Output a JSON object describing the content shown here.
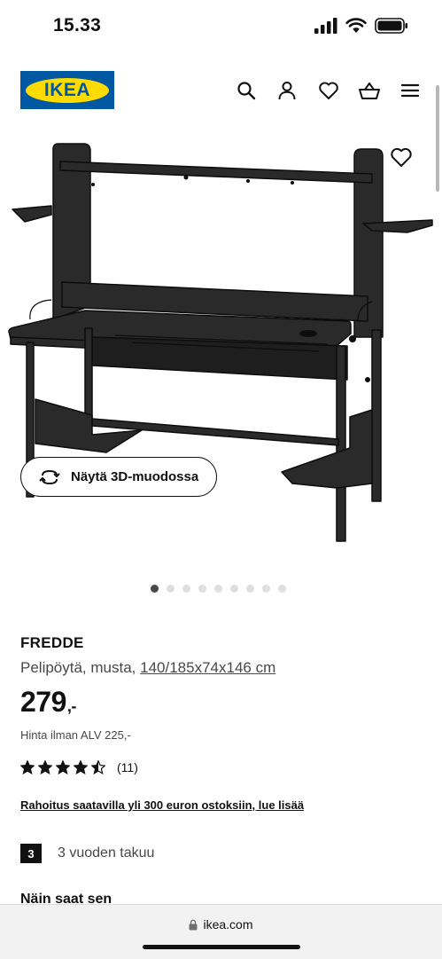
{
  "status": {
    "time": "15.33",
    "icons": [
      "signal-icon",
      "wifi-icon",
      "battery-icon"
    ]
  },
  "header": {
    "logo_text": "IKEA",
    "icons": [
      "search-icon",
      "account-icon",
      "favorites-icon",
      "cart-icon",
      "menu-icon"
    ]
  },
  "gallery": {
    "button_3d_label": "Näytä 3D-muodossa",
    "image_count": 9,
    "active_index": 0
  },
  "product": {
    "name": "FREDDE",
    "description": "Pelipöytä, musta,",
    "dimensions": "140/185x74x146 cm",
    "price": "279",
    "price_suffix": ",-",
    "price_vat": "Hinta ilman ALV 225,-",
    "rating_value": 4.5,
    "rating_count": "(11)",
    "financing_link": "Rahoitus saatavilla yli 300 euron ostoksiin, lue lisää",
    "warranty_years": "3",
    "warranty_text": "3 vuoden takuu",
    "section_heading": "Näin saat sen"
  },
  "browser": {
    "url": "ikea.com"
  },
  "colors": {
    "ikea_blue": "#0058a3",
    "ikea_yellow": "#ffdb00",
    "text_primary": "#111111",
    "text_secondary": "#484848"
  }
}
